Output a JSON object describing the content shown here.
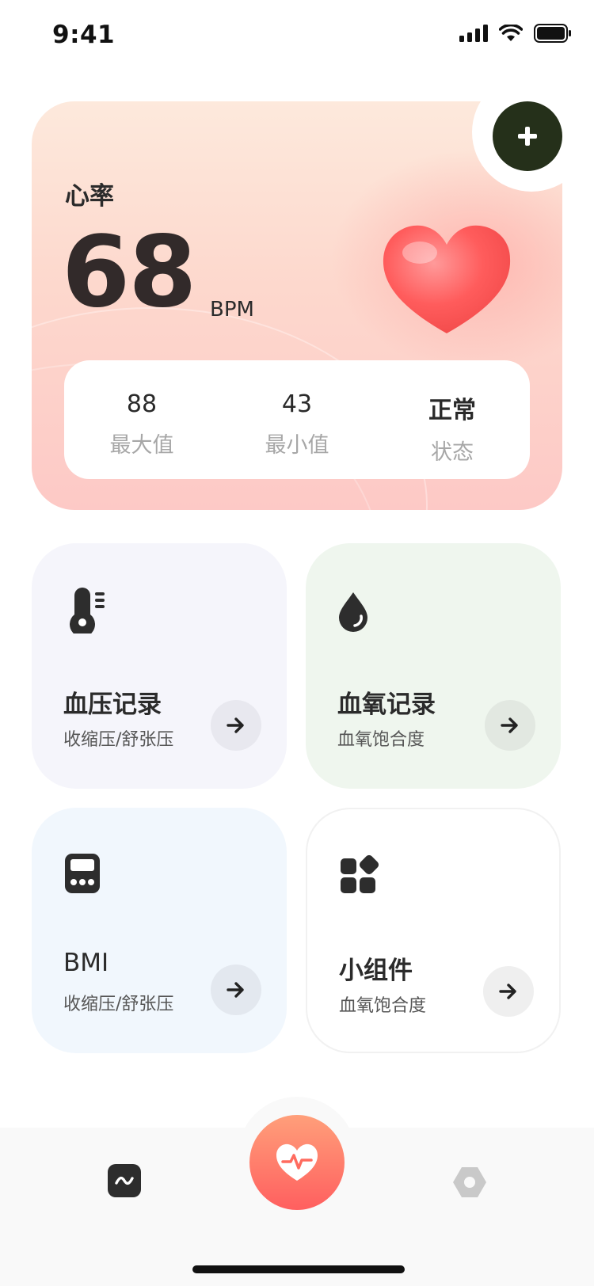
{
  "status_bar": {
    "time": "9:41"
  },
  "heart_rate": {
    "title": "心率",
    "value": "68",
    "unit": "BPM",
    "stats": [
      {
        "value": "88",
        "label": "最大值"
      },
      {
        "value": "43",
        "label": "最小值"
      },
      {
        "value": "正常",
        "label": "状态"
      }
    ]
  },
  "cards": [
    {
      "title": "血压记录",
      "subtitle": "收缩压/舒张压",
      "icon": "thermometer-icon",
      "bg": "#f5f5fb"
    },
    {
      "title": "血氧记录",
      "subtitle": "血氧饱合度",
      "icon": "drop-icon",
      "bg": "#eff6ee"
    },
    {
      "title": "BMI",
      "subtitle": "收缩压/舒张压",
      "icon": "calculator-icon",
      "bg": "#f1f7fd"
    },
    {
      "title": "小组件",
      "subtitle": "血氧饱合度",
      "icon": "widgets-icon",
      "bg": "#ffffff"
    }
  ],
  "tab_bar": {
    "items": [
      {
        "icon": "wave-icon"
      },
      {
        "icon": "heartbeat-icon",
        "active": true
      },
      {
        "icon": "settings-icon"
      }
    ]
  },
  "colors": {
    "accent": "#ff6b5f",
    "dark_button": "#25301a"
  }
}
